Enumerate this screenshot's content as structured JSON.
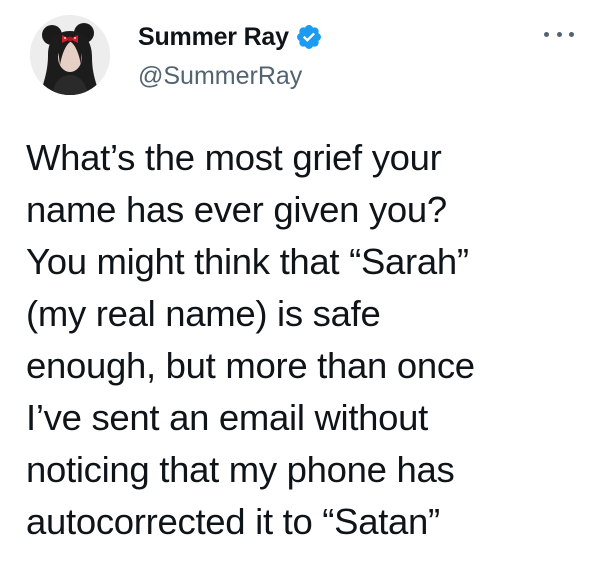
{
  "tweet": {
    "author": {
      "display_name": "Summer Ray",
      "handle": "@SummerRay",
      "verified": true,
      "verified_color": "#1d9bf0"
    },
    "more_icon": "more-horizontal-icon",
    "text_lines": [
      "What’s the most grief your",
      "name has ever given you?",
      "You might think that “Sarah”",
      "(my real name) is safe",
      "enough, but more than once",
      "I’ve sent an email without",
      "noticing that my phone has",
      "autocorrected it to “Satan”"
    ]
  }
}
